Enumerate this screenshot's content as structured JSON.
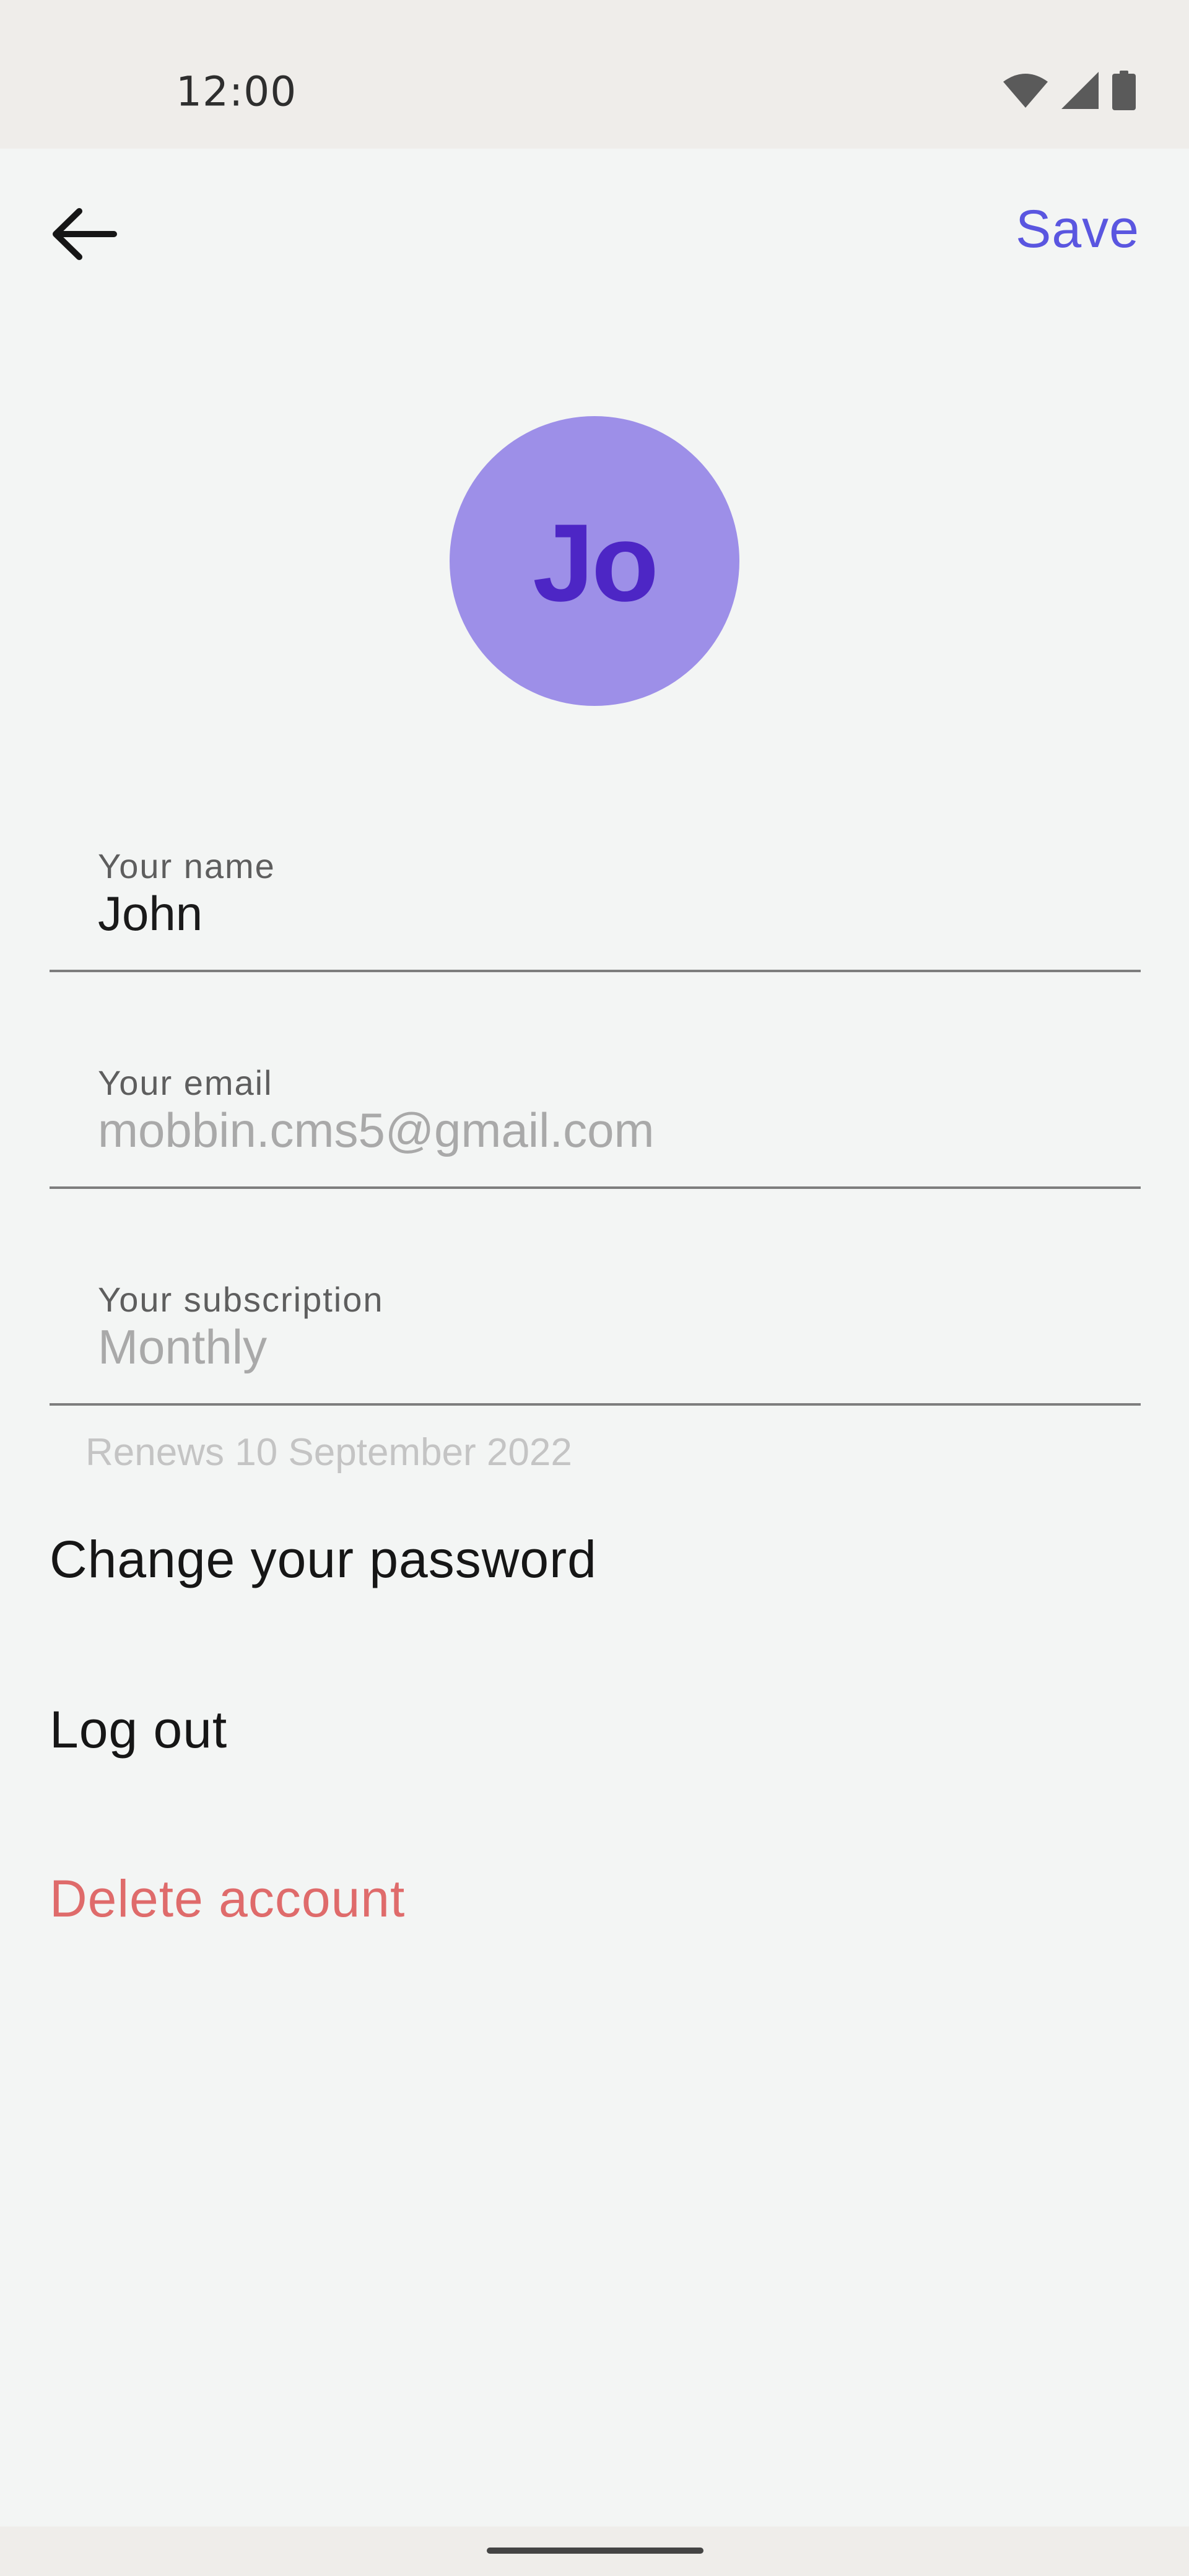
{
  "status_bar": {
    "time": "12:00",
    "icons": [
      "wifi-icon",
      "cellular-signal-icon",
      "battery-icon"
    ]
  },
  "header": {
    "back_icon": "arrow-left-icon",
    "save_label": "Save"
  },
  "profile": {
    "avatar_initials": "Jo",
    "avatar_color": "#9d8fe8",
    "initials_color": "#4d26c5"
  },
  "form": {
    "name": {
      "label": "Your name",
      "value": "John"
    },
    "email": {
      "label": "Your email",
      "value": "mobbin.cms5@gmail.com"
    },
    "subscription": {
      "label": "Your subscription",
      "value": "Monthly",
      "helper": "Renews 10 September 2022"
    }
  },
  "actions": {
    "change_password": "Change your password",
    "log_out": "Log out",
    "delete_account": "Delete account"
  },
  "colors": {
    "accent": "#5a56e0",
    "danger": "#df6b6b",
    "background": "#f3f5f4"
  }
}
